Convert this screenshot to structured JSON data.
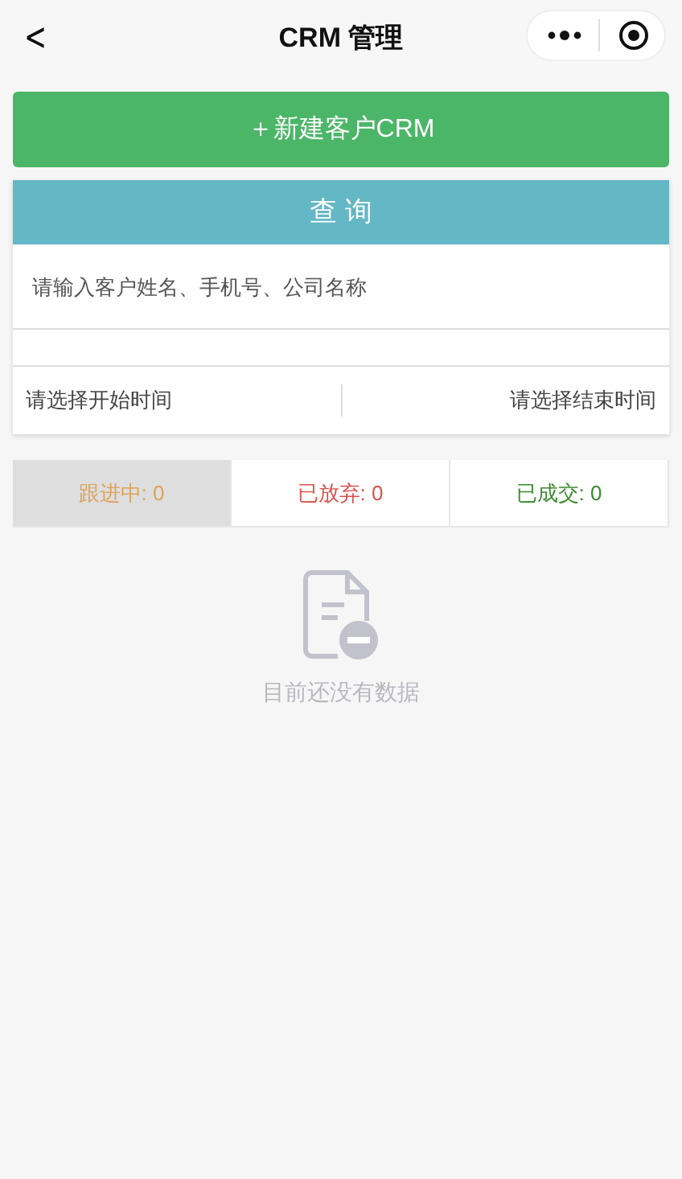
{
  "nav_bar": {
    "back_glyph": "<",
    "title": "CRM 管理"
  },
  "new_button": {
    "label": "＋新建客户CRM"
  },
  "query_panel": {
    "title": "查 询",
    "search": {
      "placeholder": "请输入客户姓名、手机号、公司名称"
    },
    "start_time": "请选择开始时间",
    "end_time": "请选择结束时间"
  },
  "status_tabs": [
    {
      "label": "跟进中: 0",
      "selected": true,
      "color": "#dba35a"
    },
    {
      "label": "已放弃: 0",
      "selected": false,
      "color": "#d9534f"
    },
    {
      "label": "已成交: 0",
      "selected": false,
      "color": "#3c8a2e"
    }
  ],
  "empty_state": {
    "message": "目前还没有数据"
  }
}
